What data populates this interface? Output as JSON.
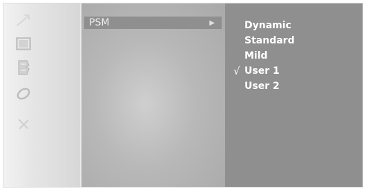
{
  "menu": {
    "item_label": "PSM",
    "arrow_glyph": "▶"
  },
  "options": {
    "items": [
      {
        "label": "Dynamic",
        "checked": false
      },
      {
        "label": "Standard",
        "checked": false
      },
      {
        "label": "Mild",
        "checked": false
      },
      {
        "label": "User 1",
        "checked": true
      },
      {
        "label": "User 2",
        "checked": false
      }
    ],
    "check_glyph": "√"
  },
  "icons": [
    "picture-icon",
    "sound-icon",
    "time-icon",
    "special-icon",
    "screen-icon",
    "setup-icon"
  ],
  "colors": {
    "highlight": "#8f8f8f",
    "option_text": "#ffffff",
    "rail": "#e2e2e2"
  }
}
